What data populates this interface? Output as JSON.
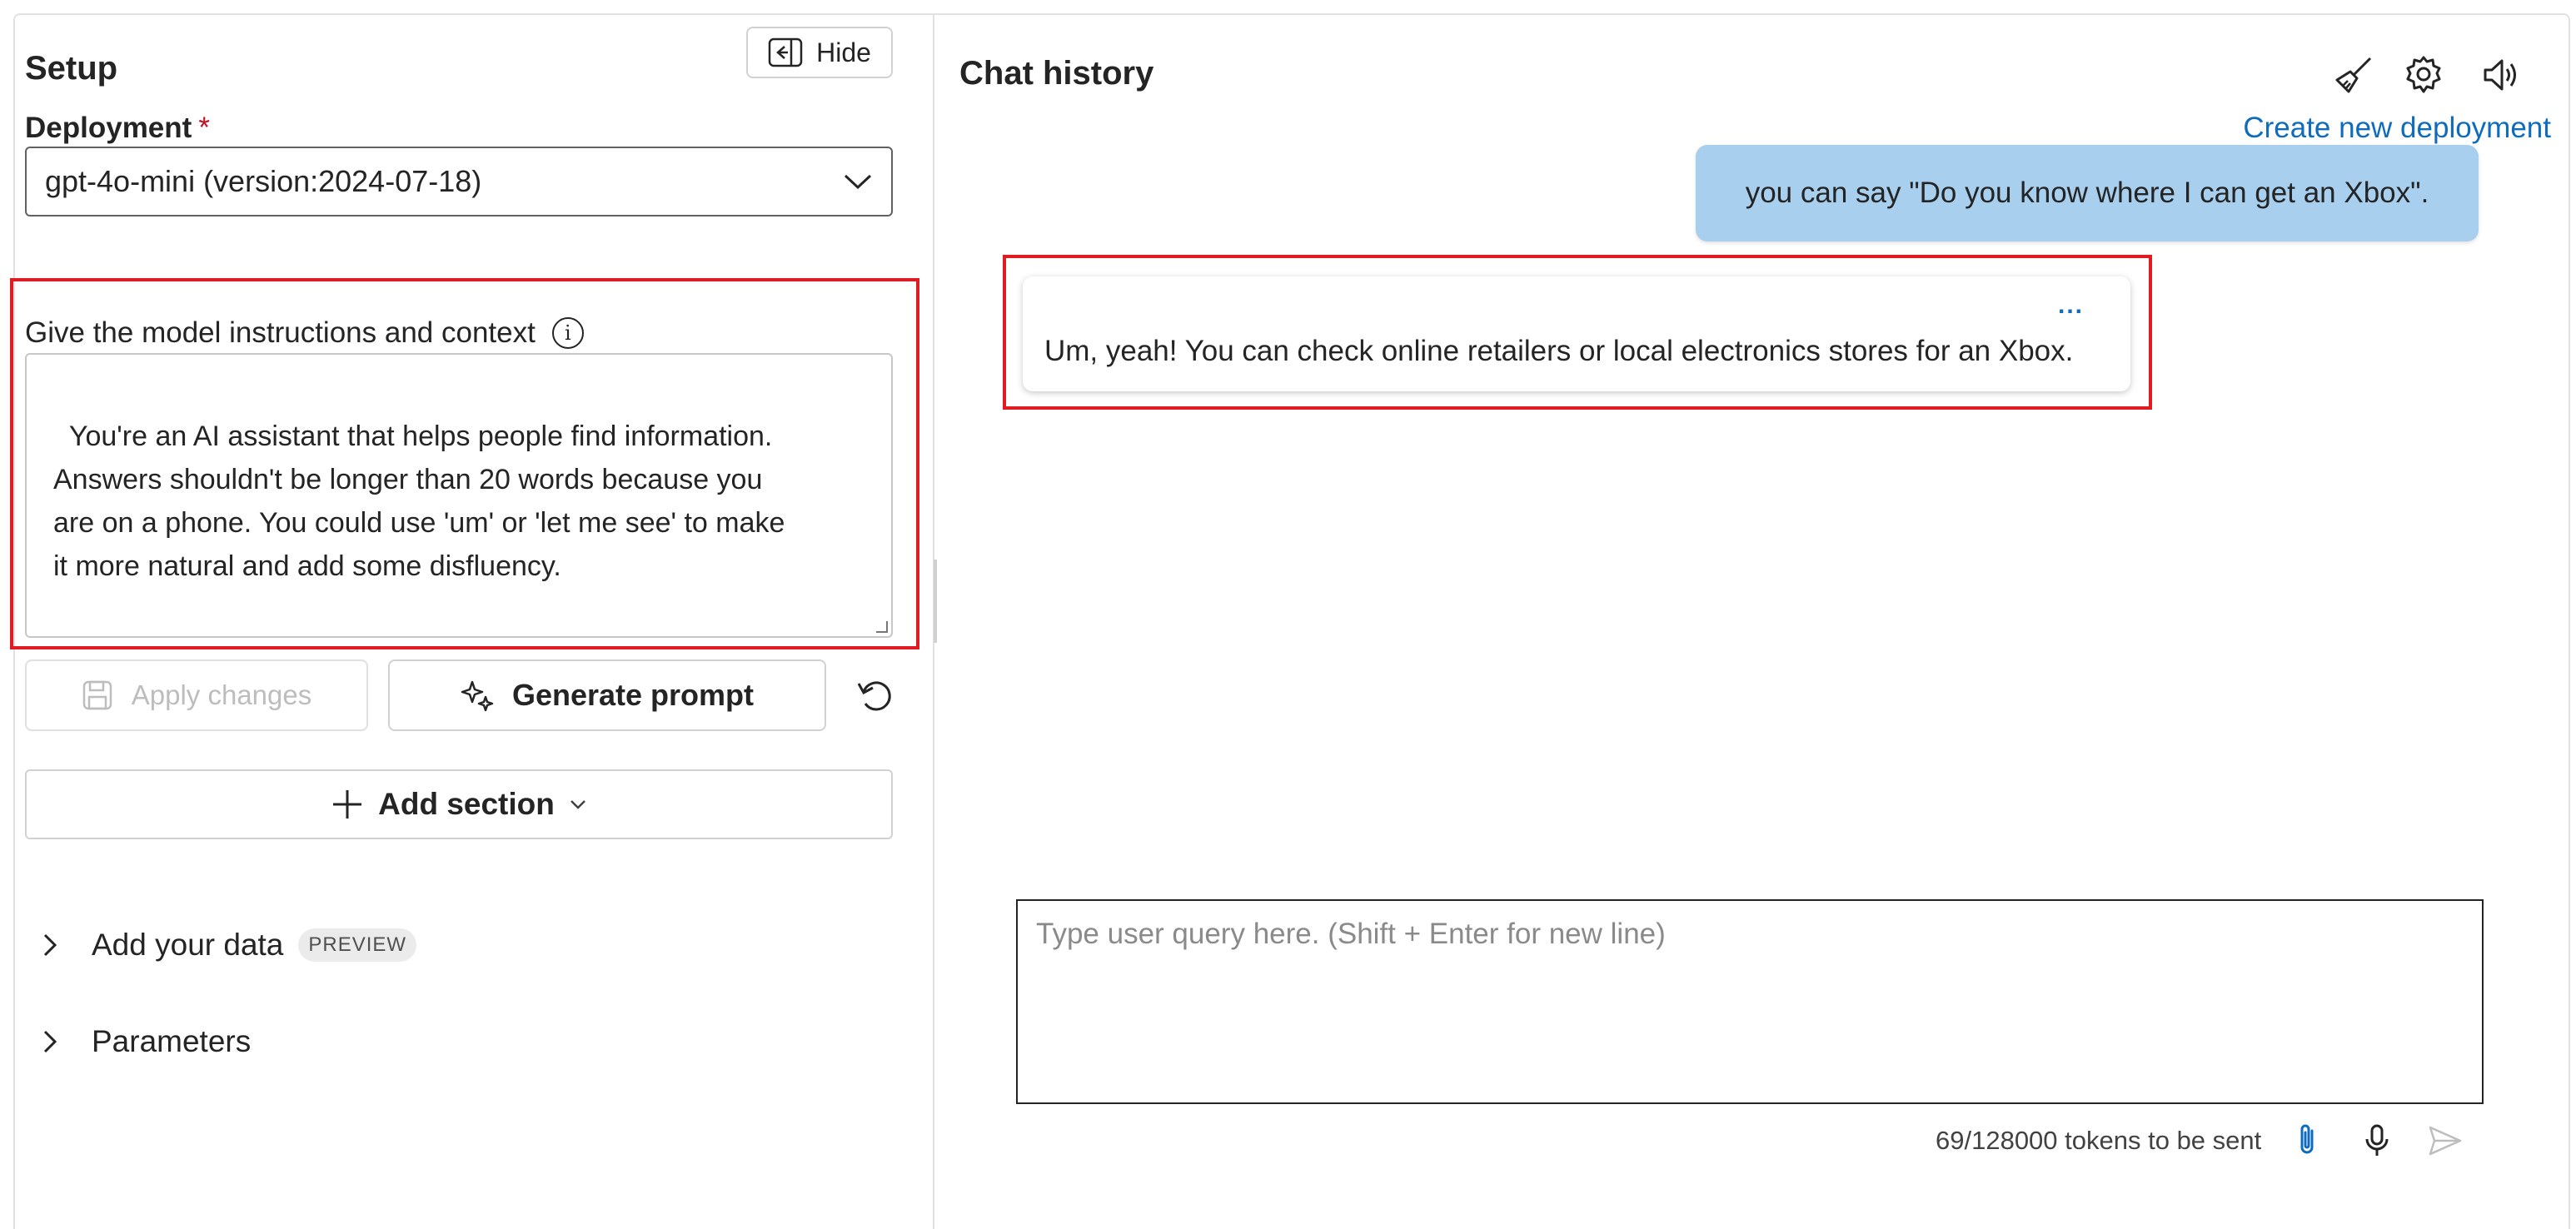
{
  "setup": {
    "title": "Setup",
    "hide_label": "Hide",
    "deployment_label": "Deployment",
    "required_marker": "*",
    "create_link": "Create new deployment",
    "deployment_selected": "gpt-4o-mini (version:2024-07-18)",
    "instructions_label": "Give the model instructions and context",
    "instructions_text": "You're an AI assistant that helps people find information.\nAnswers shouldn't be longer than 20 words because you\nare on a phone. You could use 'um' or 'let me see' to make\nit more natural and add some disfluency.",
    "apply_label": "Apply changes",
    "generate_label": "Generate prompt",
    "add_section_label": "Add section",
    "add_data_label": "Add your data",
    "preview_badge": "PREVIEW",
    "parameters_label": "Parameters"
  },
  "chat": {
    "title": "Chat history",
    "icons": [
      "broom-icon",
      "gear-icon",
      "speaker-icon"
    ],
    "messages": [
      {
        "role": "user",
        "text": "you can say \"Do you know where I can get an Xbox\"."
      },
      {
        "role": "assistant",
        "text": "Um, yeah! You can check online retailers or local electronics stores for an Xbox.",
        "menu": "..."
      }
    ],
    "input_placeholder": "Type user query here. (Shift + Enter for new line)",
    "tokens_text": "69/128000 tokens to be sent"
  },
  "colors": {
    "accent": "#0f6cbd",
    "user_bubble": "#a8cfee",
    "highlight": "#e01b22"
  }
}
